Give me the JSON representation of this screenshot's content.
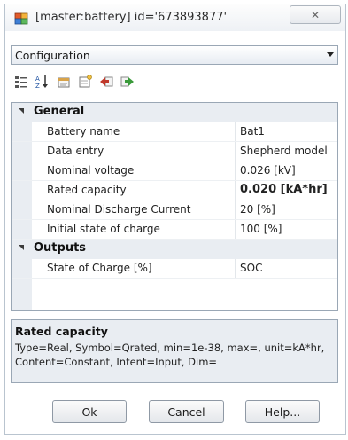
{
  "window": {
    "title": "[master:battery] id='673893877'",
    "close_glyph": "✕"
  },
  "combo": {
    "selected": "Configuration"
  },
  "toolbar": {
    "icons": [
      "categorized-icon",
      "alphabetical-sort-icon",
      "properties-icon",
      "property-pages-icon",
      "import-icon",
      "export-icon"
    ]
  },
  "grid": {
    "categories": [
      {
        "label": "General",
        "rows": [
          {
            "name": "Battery name",
            "value": "Bat1"
          },
          {
            "name": "Data entry",
            "value": "Shepherd model"
          },
          {
            "name": "Nominal voltage",
            "value": "0.026 [kV]"
          },
          {
            "name": "Rated capacity",
            "value": "0.020 [kA*hr]"
          },
          {
            "name": "Nominal Discharge Current",
            "value": "20 [%]"
          },
          {
            "name": "Initial state of charge",
            "value": "100 [%]"
          }
        ]
      },
      {
        "label": "Outputs",
        "rows": [
          {
            "name": "State of Charge [%]",
            "value": "SOC"
          }
        ]
      }
    ]
  },
  "description": {
    "title": "Rated capacity",
    "text": "Type=Real, Symbol=Qrated, min=1e-38, max=, unit=kA*hr, Content=Constant, Intent=Input, Dim="
  },
  "buttons": {
    "ok": "Ok",
    "cancel": "Cancel",
    "help": "Help..."
  },
  "colors": {
    "accent_red": "#c0392b",
    "accent_green": "#3a9a3a",
    "gutter": "#e9edf2"
  }
}
